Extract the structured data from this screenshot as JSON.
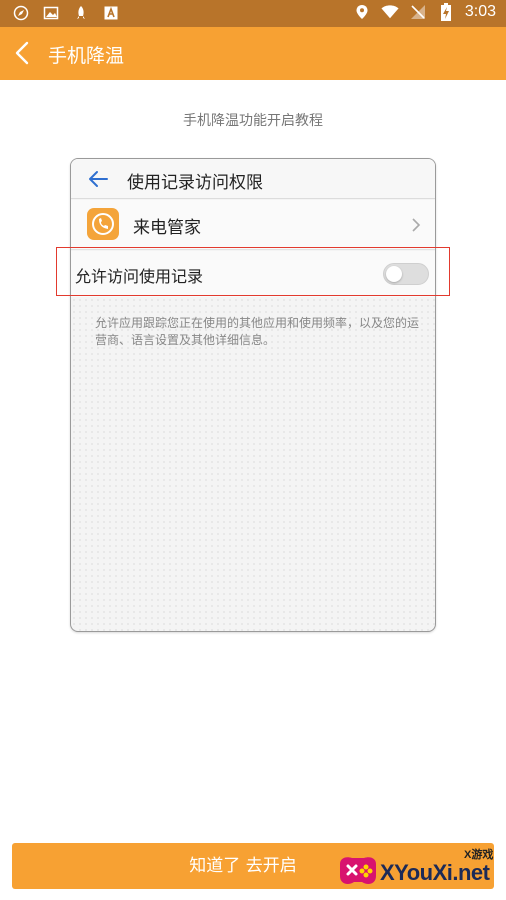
{
  "status_bar": {
    "time": "3:03",
    "left_icons": [
      "compass-icon",
      "image-icon",
      "rocket-icon",
      "font-icon"
    ],
    "right_icons": [
      "location-icon",
      "wifi-icon",
      "no-signal-icon",
      "battery-charging-icon"
    ]
  },
  "app_bar": {
    "title": "手机降温",
    "back_icon": "back-arrow-icon",
    "color": "#f7a133"
  },
  "page": {
    "subtitle": "手机降温功能开启教程"
  },
  "tutorial_card": {
    "header_title": "使用记录访问权限",
    "app_row": {
      "name": "来电管家",
      "icon": "phone-manager-icon"
    },
    "toggle_row": {
      "label": "允许访问使用记录",
      "enabled": false
    },
    "description": "允许应用跟踪您正在使用的其他应用和使用频率，以及您的运营商、语言设置及其他详细信息。",
    "highlight_color": "#e23a2e"
  },
  "bottom_button": {
    "label": "知道了 去开启"
  },
  "watermark": {
    "small_text": "X游戏",
    "text": "XYouXi.net"
  }
}
